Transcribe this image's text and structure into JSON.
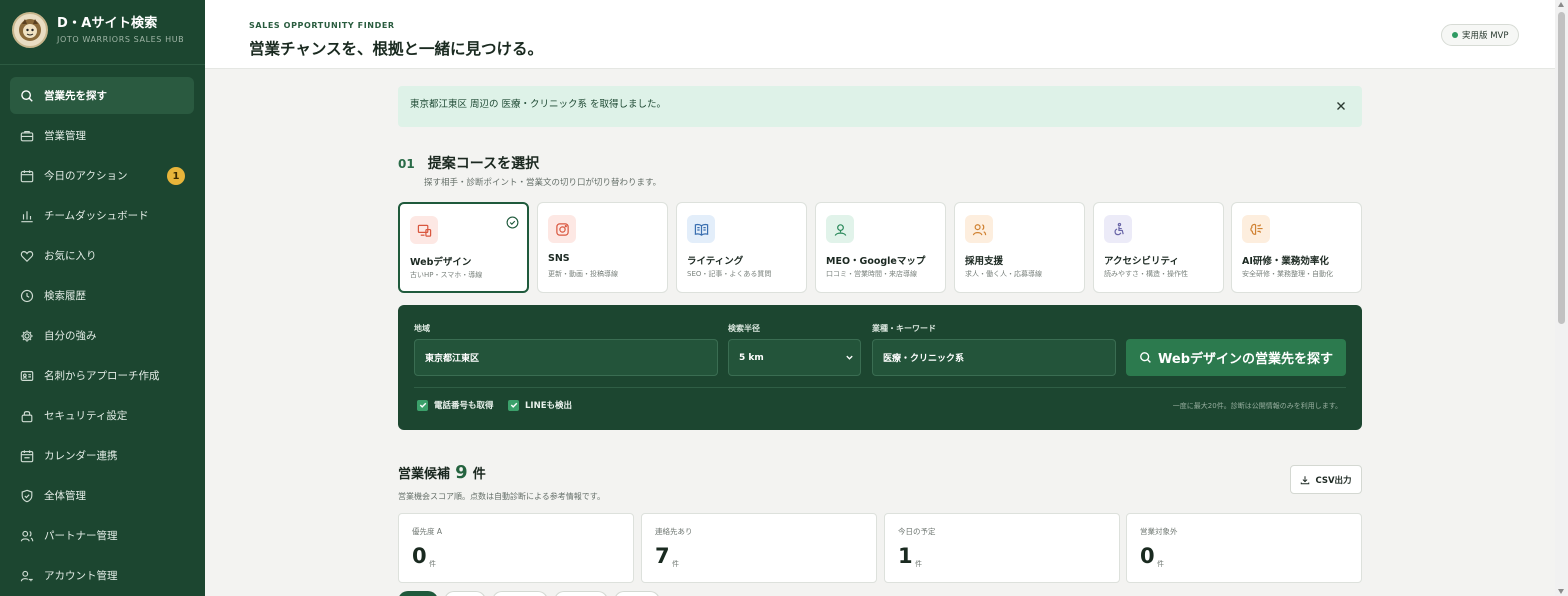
{
  "brand": {
    "title": "D・Aサイト検索",
    "subtitle": "JOTO WARRIORS SALES HUB",
    "logo_icon": "mascot-logo"
  },
  "sidebar": {
    "items": [
      {
        "label": "営業先を探す",
        "icon": "search-icon",
        "active": true
      },
      {
        "label": "営業管理",
        "icon": "briefcase-icon"
      },
      {
        "label": "今日のアクション",
        "icon": "calendar-icon",
        "badge": "1"
      },
      {
        "label": "チームダッシュボード",
        "icon": "bar-chart-icon"
      },
      {
        "label": "お気に入り",
        "icon": "heart-icon"
      },
      {
        "label": "検索履歴",
        "icon": "clock-icon"
      },
      {
        "label": "自分の強み",
        "icon": "gear-icon"
      },
      {
        "label": "名刺からアプローチ作成",
        "icon": "id-card-icon"
      },
      {
        "label": "セキュリティ設定",
        "icon": "lock-icon"
      },
      {
        "label": "カレンダー連携",
        "icon": "calendar-sync-icon"
      },
      {
        "label": "全体管理",
        "icon": "shield-icon"
      },
      {
        "label": "パートナー管理",
        "icon": "users-icon"
      },
      {
        "label": "アカウント管理",
        "icon": "user-key-icon"
      }
    ]
  },
  "header": {
    "eyebrow": "SALES OPPORTUNITY FINDER",
    "title": "営業チャンスを、根拠と一緒に見つける。",
    "version": "実用版 MVP"
  },
  "notice": {
    "text": "東京都江東区 周辺の 医療・クリニック系 を取得しました。"
  },
  "section": {
    "number": "01",
    "title": "提案コースを選択",
    "description": "探す相手・診断ポイント・営業文の切り口が切り替わります。"
  },
  "courses": [
    {
      "name": "Webデザイン",
      "sub": "古いHP・スマホ・導線",
      "icon": "devices-icon",
      "bg": "#fde8e4",
      "fg": "#d9573f",
      "selected": true
    },
    {
      "name": "SNS",
      "sub": "更新・動画・投稿導線",
      "icon": "instagram-icon",
      "bg": "#fde8e4",
      "fg": "#d9573f"
    },
    {
      "name": "ライティング",
      "sub": "SEO・記事・よくある質問",
      "icon": "book-icon",
      "bg": "#e3eefa",
      "fg": "#3a6fb0"
    },
    {
      "name": "MEO・Googleマップ",
      "sub": "口コミ・営業時間・来店導線",
      "icon": "map-pin-icon",
      "bg": "#e1f3ea",
      "fg": "#2c8a5c"
    },
    {
      "name": "採用支援",
      "sub": "求人・働く人・応募導線",
      "icon": "people-icon",
      "bg": "#fdeede",
      "fg": "#d08233"
    },
    {
      "name": "アクセシビリティ",
      "sub": "読みやすさ・構造・操作性",
      "icon": "accessibility-icon",
      "bg": "#ecebf8",
      "fg": "#6a66a8"
    },
    {
      "name": "AI研修・業務効率化",
      "sub": "安全研修・業務整理・自動化",
      "icon": "ai-brain-icon",
      "bg": "#fdeede",
      "fg": "#d08233"
    }
  ],
  "search": {
    "area_label": "地域",
    "area_value": "東京都江東区",
    "radius_label": "検索半径",
    "radius_value": "5 km",
    "keyword_label": "業種・キーワード",
    "keyword_value": "医療・クリニック系",
    "button_label": "Webデザインの営業先を探す",
    "option_phone": "電話番号も取得",
    "option_line": "LINEも検出",
    "note": "一度に最大20件。診断は公開情報のみを利用します。"
  },
  "results": {
    "title": "営業候補",
    "count": "9",
    "unit": "件",
    "description": "営業機会スコア順。点数は自動診断による参考情報です。",
    "csv_label": "CSV出力"
  },
  "stats": [
    {
      "label": "優先度 A",
      "value": "0",
      "unit": "件"
    },
    {
      "label": "連絡先あり",
      "value": "7",
      "unit": "件"
    },
    {
      "label": "今日の予定",
      "value": "1",
      "unit": "件"
    },
    {
      "label": "営業対象外",
      "value": "0",
      "unit": "件"
    }
  ],
  "colors": {
    "sidebar": "#1c4630",
    "accent": "#2c7a4e",
    "badge": "#e8b53a"
  }
}
